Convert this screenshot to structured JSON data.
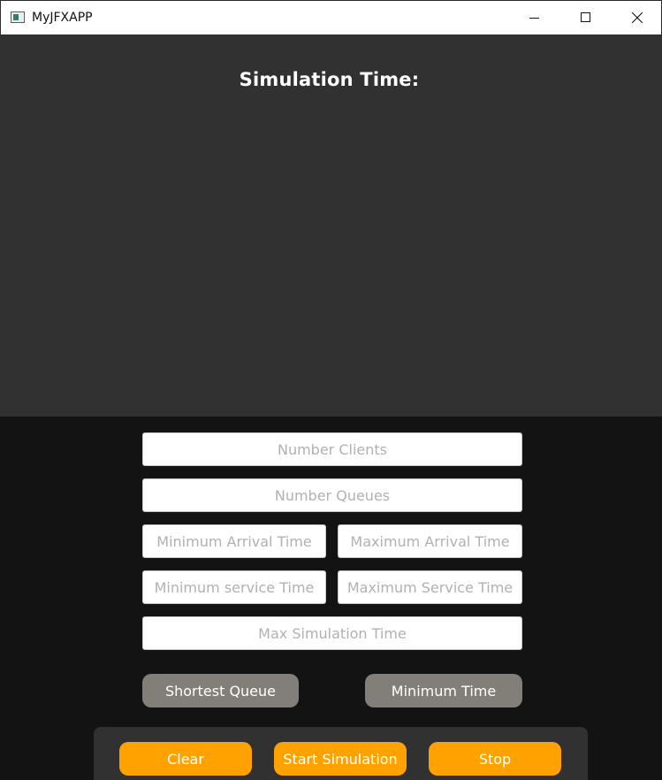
{
  "window": {
    "title": "MyJFXAPP",
    "icon": "app-window-icon",
    "controls": [
      "minimize-icon",
      "maximize-icon",
      "close-icon"
    ]
  },
  "simulation": {
    "time_label": "Simulation Time:"
  },
  "form": {
    "number_clients_placeholder": "Number Clients",
    "number_queues_placeholder": "Number Queues",
    "min_arrival_placeholder": "Minimum Arrival Time",
    "max_arrival_placeholder": "Maximum Arrival Time",
    "min_service_placeholder": "Minimum service Time",
    "max_service_placeholder": "Maximum Service Time",
    "max_simulation_placeholder": "Max Simulation Time"
  },
  "strategy": {
    "shortest_queue_label": "Shortest Queue",
    "minimum_time_label": "Minimum Time"
  },
  "actions": {
    "clear_label": "Clear",
    "start_label": "Start Simulation",
    "stop_label": "Stop"
  },
  "colors": {
    "titlebar_bg": "#ffffff",
    "sim_panel_bg": "#313131",
    "body_bg": "#131313",
    "strategy_button_bg": "#827e78",
    "action_button_bg": "#ffa200",
    "action_bar_bg": "#313131"
  }
}
